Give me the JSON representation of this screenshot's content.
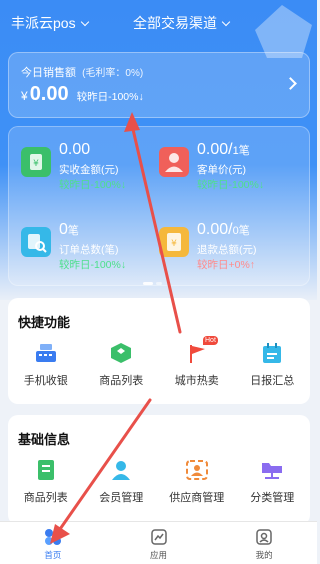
{
  "header": {
    "store_name": "丰派云pos",
    "channel": "全部交易渠道"
  },
  "sales": {
    "title": "今日销售额",
    "margin_rate": "(毛利率：0%)",
    "currency": "¥",
    "amount": "0.00",
    "compare": "较昨日-100%↓"
  },
  "stats": [
    {
      "value": "0.00",
      "unit": "",
      "label": "实收金额(元)",
      "compare": "较昨日-100%↓",
      "icon": "cash-icon",
      "color": "#3bbf6a"
    },
    {
      "value": "0.00/",
      "unit": "1笔",
      "label": "客单价(元)",
      "compare": "较昨日-100%↓",
      "icon": "customer-icon",
      "color": "#f0605a"
    },
    {
      "value": "0",
      "unit": "笔",
      "label": "订单总数(笔)",
      "compare": "较昨日-100%↓",
      "icon": "order-search-icon",
      "color": "#35b8e8"
    },
    {
      "value": "0.00/",
      "unit": "0笔",
      "label": "退款总额(元)",
      "compare": "较昨日+0%↑",
      "icon": "refund-icon",
      "color": "#f5b83c"
    }
  ],
  "quick": {
    "title": "快捷功能",
    "items": [
      {
        "label": "手机收银",
        "icon": "cash-register-icon"
      },
      {
        "label": "商品列表",
        "icon": "product-list-icon"
      },
      {
        "label": "城市热卖",
        "icon": "hot-flag-icon",
        "badge": "Hot"
      },
      {
        "label": "日报汇总",
        "icon": "daily-report-icon"
      }
    ]
  },
  "basic": {
    "title": "基础信息",
    "items": [
      {
        "label": "商品列表",
        "icon": "product-list-icon"
      },
      {
        "label": "会员管理",
        "icon": "member-icon"
      },
      {
        "label": "供应商管理",
        "icon": "supplier-icon"
      },
      {
        "label": "分类管理",
        "icon": "category-folder-icon"
      }
    ]
  },
  "tabs": [
    {
      "label": "首页",
      "icon": "home-icon",
      "active": true
    },
    {
      "label": "应用",
      "icon": "apps-icon",
      "active": false
    },
    {
      "label": "我的",
      "icon": "profile-icon",
      "active": false
    }
  ],
  "colors": {
    "primary": "#3b8cf5",
    "annotation": "#e8504a"
  }
}
